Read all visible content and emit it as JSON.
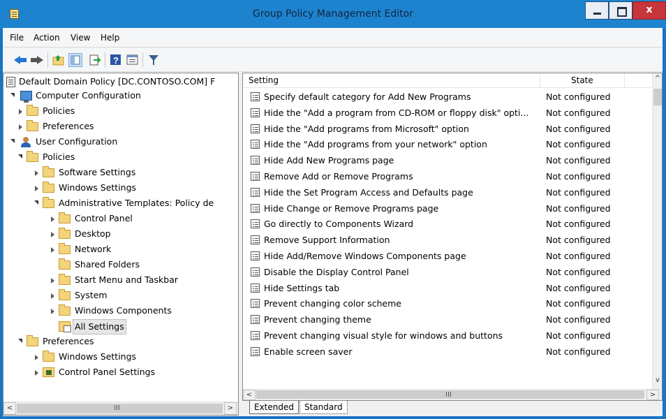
{
  "window": {
    "title": "Group Policy Management Editor",
    "close_glyph": "x"
  },
  "menu": {
    "items": [
      "File",
      "Action",
      "View",
      "Help"
    ]
  },
  "toolbar": {
    "icons": [
      "back-arrow-icon",
      "forward-arrow-icon",
      "up-folder-icon",
      "show-hide-tree-icon",
      "export-list-icon",
      "help-icon",
      "properties-icon",
      "filter-icon"
    ]
  },
  "tree": {
    "root": "Default Domain Policy [DC.CONTOSO.COM] F",
    "computer_config": "Computer Configuration",
    "cc_policies": "Policies",
    "cc_preferences": "Preferences",
    "user_config": "User Configuration",
    "uc_policies": "Policies",
    "software_settings": "Software Settings",
    "windows_settings": "Windows Settings",
    "admin_templates": "Administrative Templates: Policy de",
    "control_panel": "Control Panel",
    "desktop": "Desktop",
    "network": "Network",
    "shared_folders": "Shared Folders",
    "start_menu": "Start Menu and Taskbar",
    "system": "System",
    "windows_components": "Windows Components",
    "all_settings": "All Settings",
    "uc_preferences": "Preferences",
    "pref_windows_settings": "Windows Settings",
    "pref_control_panel_settings": "Control Panel Settings"
  },
  "list": {
    "columns": {
      "setting": "Setting",
      "state": "State"
    },
    "rows": [
      {
        "name": "Specify default category for Add New Programs",
        "state": "Not configured"
      },
      {
        "name": "Hide the \"Add a program from CD-ROM or floppy disk\" opti...",
        "state": "Not configured"
      },
      {
        "name": "Hide the \"Add programs from Microsoft\" option",
        "state": "Not configured"
      },
      {
        "name": "Hide the \"Add programs from your network\" option",
        "state": "Not configured"
      },
      {
        "name": "Hide Add New Programs page",
        "state": "Not configured"
      },
      {
        "name": "Remove Add or Remove Programs",
        "state": "Not configured"
      },
      {
        "name": "Hide the Set Program Access and Defaults page",
        "state": "Not configured"
      },
      {
        "name": "Hide Change or Remove Programs page",
        "state": "Not configured"
      },
      {
        "name": "Go directly to Components Wizard",
        "state": "Not configured"
      },
      {
        "name": "Remove Support Information",
        "state": "Not configured"
      },
      {
        "name": "Hide Add/Remove Windows Components page",
        "state": "Not configured"
      },
      {
        "name": "Disable the Display Control Panel",
        "state": "Not configured"
      },
      {
        "name": "Hide Settings tab",
        "state": "Not configured"
      },
      {
        "name": "Prevent changing color scheme",
        "state": "Not configured"
      },
      {
        "name": "Prevent changing theme",
        "state": "Not configured"
      },
      {
        "name": "Prevent changing visual style for windows and buttons",
        "state": "Not configured"
      },
      {
        "name": "Enable screen saver",
        "state": "Not configured"
      }
    ]
  },
  "tabs": {
    "extended": "Extended",
    "standard": "Standard"
  },
  "scroll": {
    "left_glyph": "<",
    "right_glyph": ">",
    "up_glyph": "^",
    "down_glyph": "v",
    "grip": "III"
  },
  "colors": {
    "titlebar": "#1e83cf",
    "close_button": "#c7363a",
    "folder": "#f3d47b"
  }
}
